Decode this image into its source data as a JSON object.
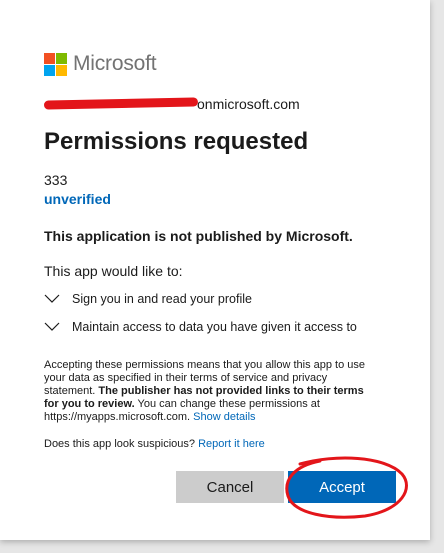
{
  "brand": {
    "name": "Microsoft",
    "colors": {
      "red": "#f25022",
      "green": "#7fba00",
      "blue": "#00a4ef",
      "yellow": "#ffb900"
    }
  },
  "account": {
    "email_visible_suffix": "onmicrosoft.com"
  },
  "dialog": {
    "title": "Permissions requested",
    "app_name": "333",
    "publisher_status": "unverified",
    "not_published": "This application is not published by Microsoft.",
    "would_like": "This app would like to:",
    "permissions": [
      "Sign you in and read your profile",
      "Maintain access to data you have given it access to"
    ],
    "disclaimer_part1": "Accepting these permissions means that you allow this app to use your data as specified in their terms of service and privacy statement. ",
    "disclaimer_bold": "The publisher has not provided links to their terms for you to review.",
    "disclaimer_part2": " You can change these permissions at https://myapps.microsoft.com. ",
    "show_details": "Show details",
    "suspicious_q": "Does this app look suspicious? ",
    "report_link": "Report it here",
    "cancel_label": "Cancel",
    "accept_label": "Accept"
  },
  "theme": {
    "accent": "#0067b8",
    "cancel_bg": "#cccccc",
    "annotation": "#e3151a"
  }
}
